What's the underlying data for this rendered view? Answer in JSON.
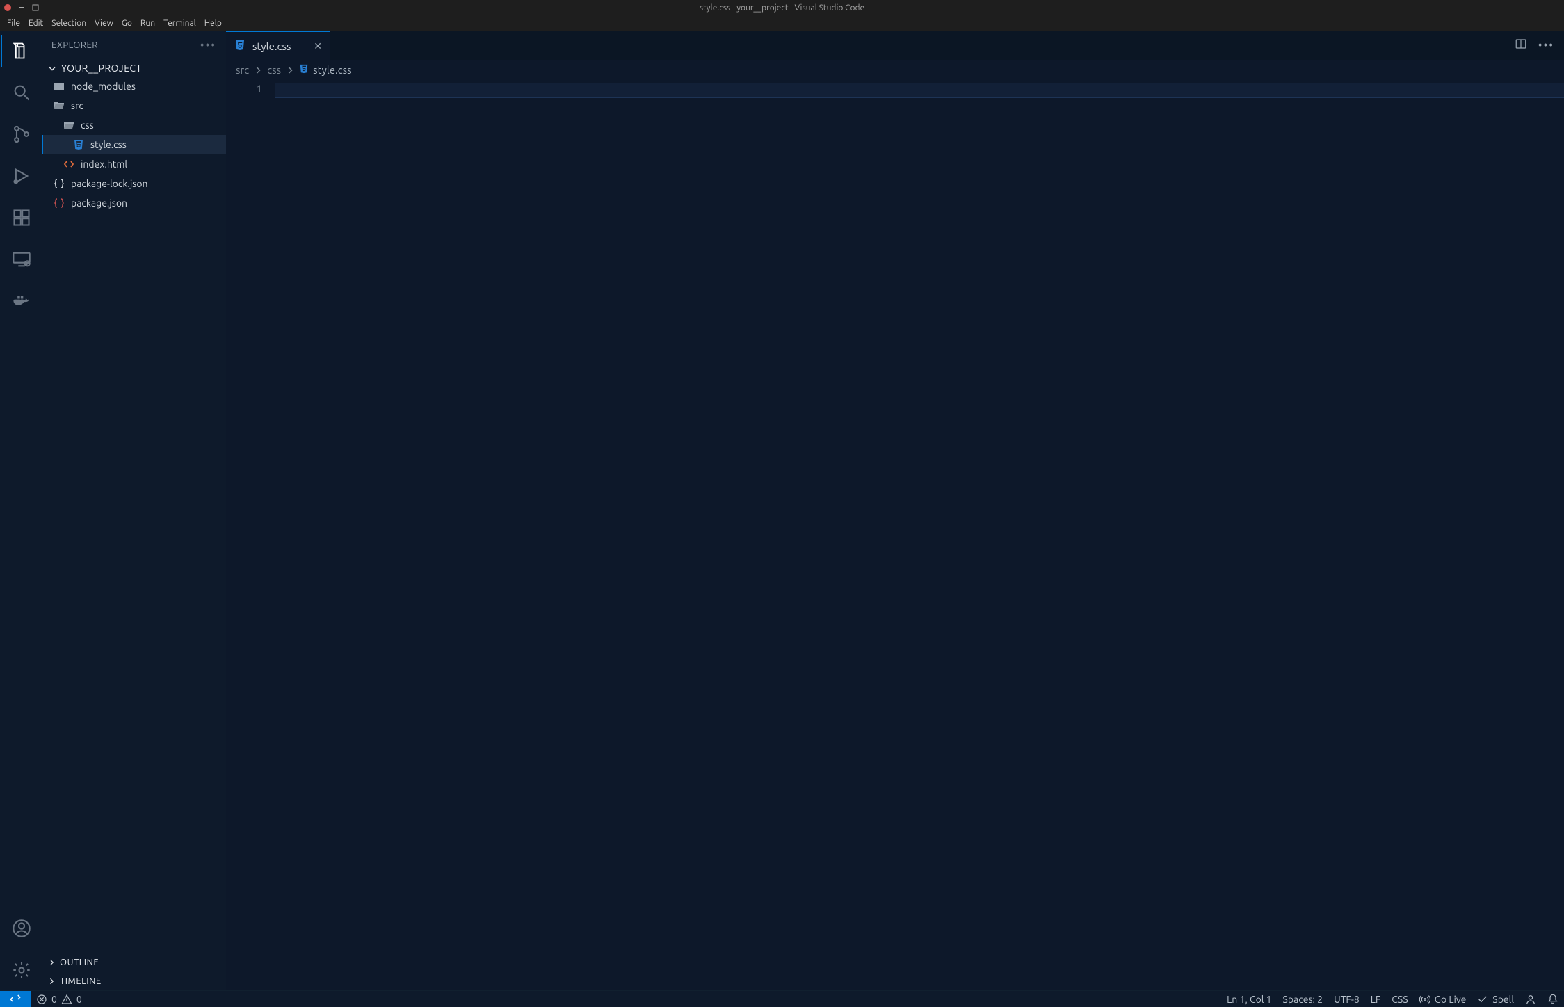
{
  "window": {
    "title": "style.css - your__project - Visual Studio Code"
  },
  "menu": [
    "File",
    "Edit",
    "Selection",
    "View",
    "Go",
    "Run",
    "Terminal",
    "Help"
  ],
  "sidebar": {
    "header": "EXPLORER",
    "root": "YOUR__PROJECT",
    "tree": [
      {
        "name": "node_modules",
        "type": "folder-closed",
        "indent": 0
      },
      {
        "name": "src",
        "type": "folder-open",
        "indent": 0
      },
      {
        "name": "css",
        "type": "folder-open",
        "indent": 1
      },
      {
        "name": "style.css",
        "type": "css",
        "indent": 2,
        "selected": true
      },
      {
        "name": "index.html",
        "type": "html",
        "indent": 1
      },
      {
        "name": "package-lock.json",
        "type": "json",
        "indent": 0
      },
      {
        "name": "package.json",
        "type": "json-red",
        "indent": 0
      }
    ],
    "sections": [
      "OUTLINE",
      "TIMELINE"
    ]
  },
  "tabs": [
    {
      "name": "style.css",
      "type": "css",
      "active": true
    }
  ],
  "breadcrumb": [
    {
      "label": "src",
      "icon": null
    },
    {
      "label": "css",
      "icon": null
    },
    {
      "label": "style.css",
      "icon": "css"
    }
  ],
  "editor": {
    "line_number": "1"
  },
  "status": {
    "errors": "0",
    "warnings": "0",
    "cursor": "Ln 1, Col 1",
    "spaces": "Spaces: 2",
    "encoding": "UTF-8",
    "eol": "LF",
    "language": "CSS",
    "golive": "Go Live",
    "spell": "Spell"
  }
}
